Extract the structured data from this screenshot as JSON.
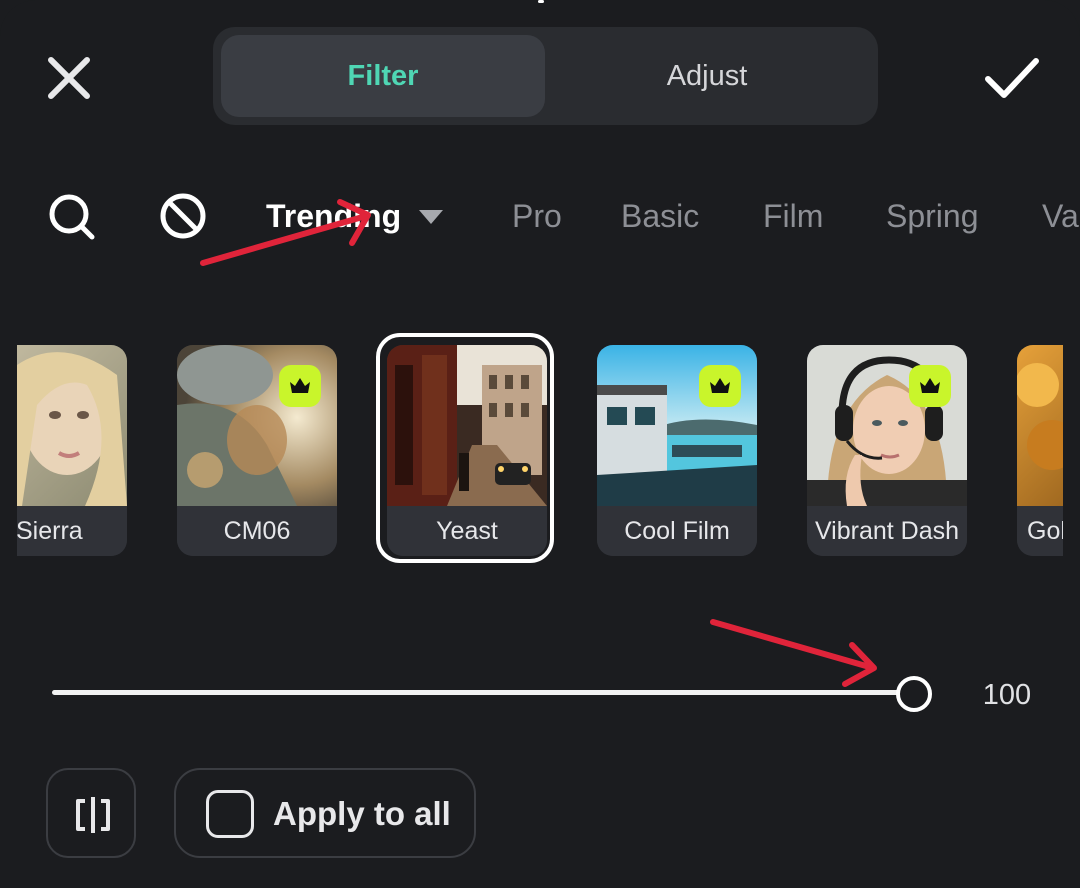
{
  "header": {
    "tabs": [
      {
        "label": "Filter",
        "active": true
      },
      {
        "label": "Adjust",
        "active": false
      }
    ]
  },
  "categories": [
    "Trending",
    "Pro",
    "Basic",
    "Film",
    "Spring",
    "Va"
  ],
  "filters": [
    {
      "label": "Sierra",
      "premium": false
    },
    {
      "label": "CM06",
      "premium": true
    },
    {
      "label": "Yeast",
      "premium": false,
      "selected": true
    },
    {
      "label": "Cool Film",
      "premium": true
    },
    {
      "label": "Vibrant Dash",
      "premium": true
    },
    {
      "label": "Gol",
      "premium": false
    }
  ],
  "slider": {
    "value": "100",
    "level_percent": 100
  },
  "bottom": {
    "apply_label": "Apply to all",
    "apply_checked": false
  },
  "colors": {
    "accent": "#4fd6b4",
    "premium_badge": "#c9f52b",
    "annotation_arrow": "#e0243a",
    "background": "#1b1c1f"
  }
}
